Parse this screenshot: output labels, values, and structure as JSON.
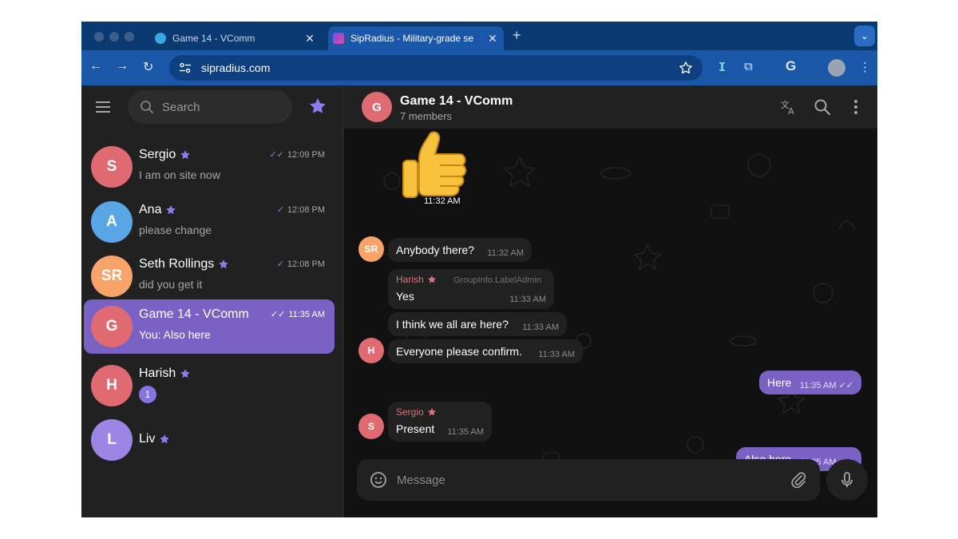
{
  "browser": {
    "tabs": [
      {
        "title": "Game 14 - VComm",
        "active": false
      },
      {
        "title": "SipRadius - Military-grade se",
        "active": true
      }
    ],
    "url": "sipradius.com",
    "accent": "#1a57a8"
  },
  "sidebar": {
    "search_placeholder": "Search",
    "chats": [
      {
        "name": "Sergio",
        "initials": "S",
        "preview": "I am on site now",
        "time": "12:09 PM",
        "color": "#e06a72",
        "read": "double"
      },
      {
        "name": "Ana",
        "initials": "A",
        "preview": "please change",
        "time": "12:08 PM",
        "color": "#58a6e6",
        "read": "single"
      },
      {
        "name": "Seth Rollings",
        "initials": "SR",
        "preview": "did you get it",
        "time": "12:08 PM",
        "color": "#f7a36a",
        "read": "single"
      },
      {
        "name": "Game 14 - VComm",
        "initials": "G",
        "preview": "You: Also here",
        "time": "11:35 AM",
        "color": "#e06a72",
        "read": "double",
        "selected": true
      },
      {
        "name": "Harish",
        "initials": "H",
        "badge": "1",
        "color": "#e06a72"
      },
      {
        "name": "Liv",
        "initials": "L",
        "color": "#9b86e6"
      }
    ]
  },
  "chat": {
    "title": "Game 14 - VComm",
    "initials": "G",
    "subtitle": "7 members",
    "sticker_time": "11:32 AM",
    "messages": [
      {
        "text": "Anybody there?",
        "time": "11:32 AM",
        "avatar": "SR"
      },
      {
        "sender": "Harish",
        "role": "GroupInfo.LabelAdmin",
        "text": "Yes",
        "time": "11:33 AM"
      },
      {
        "text": "I think we all are here?",
        "time": "11:33 AM"
      },
      {
        "text": "Everyone please confirm.",
        "time": "11:33 AM",
        "avatar": "H"
      },
      {
        "text": "Here",
        "time": "11:35 AM",
        "outgoing": true
      },
      {
        "sender": "Sergio",
        "text": "Present",
        "time": "11:35 AM",
        "avatar": "S"
      },
      {
        "text": "Also here",
        "time": "11:35 AM",
        "outgoing": true
      }
    ],
    "composer_placeholder": "Message",
    "accent": "#7a62c4"
  }
}
